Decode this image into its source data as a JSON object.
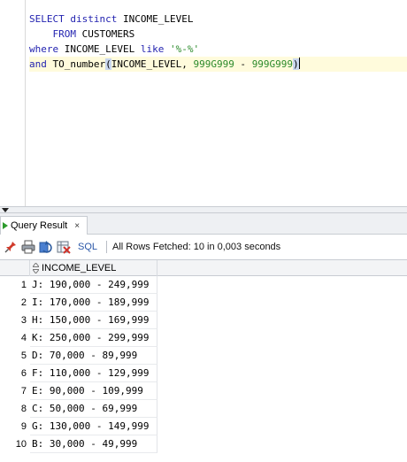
{
  "editor": {
    "line1": {
      "kw1": "SELECT distinct",
      "text": " INCOME_LEVEL"
    },
    "line2": {
      "indent": "    ",
      "kw": "FROM",
      "text": " CUSTOMERS"
    },
    "line3": {
      "kw1": "where",
      "text": " INCOME_LEVEL ",
      "kw2": "like",
      "sp": " ",
      "str": "'%-%'"
    },
    "line4": {
      "kw1": "and",
      "fn": " TO_number",
      "paren_open": "(",
      "args_a": "INCOME_LEVEL, ",
      "num1": "999G999",
      "dash": " - ",
      "num2": "999G999",
      "paren_close": ")"
    }
  },
  "results_tab": {
    "label": "Query Result",
    "close_label": "×"
  },
  "toolbar": {
    "sql_label": "SQL",
    "status": "All Rows Fetched: 10 in 0,003 seconds",
    "icons": [
      "pin-icon",
      "print-icon",
      "refresh-icon",
      "export-icon"
    ]
  },
  "grid": {
    "column": "INCOME_LEVEL",
    "rows": [
      {
        "n": "1",
        "value": "J: 190,000 - 249,999"
      },
      {
        "n": "2",
        "value": "I: 170,000 - 189,999"
      },
      {
        "n": "3",
        "value": "H: 150,000 - 169,999"
      },
      {
        "n": "4",
        "value": "K: 250,000 - 299,999"
      },
      {
        "n": "5",
        "value": "D: 70,000 - 89,999"
      },
      {
        "n": "6",
        "value": "F: 110,000 - 129,999"
      },
      {
        "n": "7",
        "value": "E: 90,000 - 109,999"
      },
      {
        "n": "8",
        "value": "C: 50,000 - 69,999"
      },
      {
        "n": "9",
        "value": "G: 130,000 - 149,999"
      },
      {
        "n": "10",
        "value": "B: 30,000 - 49,999"
      }
    ]
  },
  "colors": {
    "keyword": "#2323b0",
    "literal": "#2a8a2a",
    "current_line": "#fffbdc",
    "bracket_match": "#c9d7ef"
  }
}
